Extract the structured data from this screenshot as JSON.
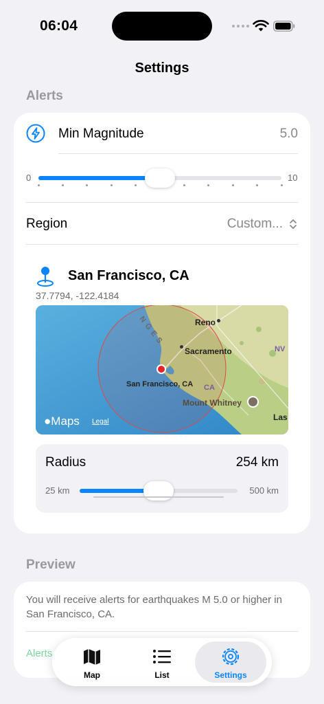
{
  "status_bar": {
    "time": "06:04"
  },
  "nav": {
    "title": "Settings"
  },
  "alerts_section": {
    "header": "Alerts",
    "magnitude": {
      "label": "Min Magnitude",
      "value": "5.0",
      "slider_min": "0",
      "slider_max": "10",
      "slider_level": 0.5,
      "tick_count": 11,
      "icon": "bolt-icon"
    },
    "region": {
      "label": "Region",
      "value": "Custom...",
      "icon": "chevron-up-down-icon"
    },
    "location": {
      "name": "San Francisco, CA",
      "coordinates": "37.7794, -122.4184",
      "icon": "map-pin-icon"
    },
    "map": {
      "labels": [
        "Reno",
        "Sacramento",
        "San Francisco, CA",
        "Mount Whitney",
        "NV",
        "CA",
        "Las",
        "NGES"
      ],
      "brand": "Maps",
      "legal": "Legal"
    },
    "radius": {
      "label": "Radius",
      "value": "254 km",
      "min": "25 km",
      "max": "500 km",
      "level": 0.5
    }
  },
  "preview_section": {
    "header": "Preview",
    "text": "You will receive alerts for earthquakes M 5.0 or higher in San Francisco, CA.",
    "link": "Alerts"
  },
  "tab_bar": {
    "tabs": [
      {
        "label": "Map",
        "icon": "map-icon"
      },
      {
        "label": "List",
        "icon": "list-icon"
      },
      {
        "label": "Settings",
        "icon": "gear-icon",
        "selected": true
      }
    ]
  },
  "colors": {
    "accent": "#0a84ff",
    "background": "#f2f2f6",
    "pin": "#e8222a"
  }
}
